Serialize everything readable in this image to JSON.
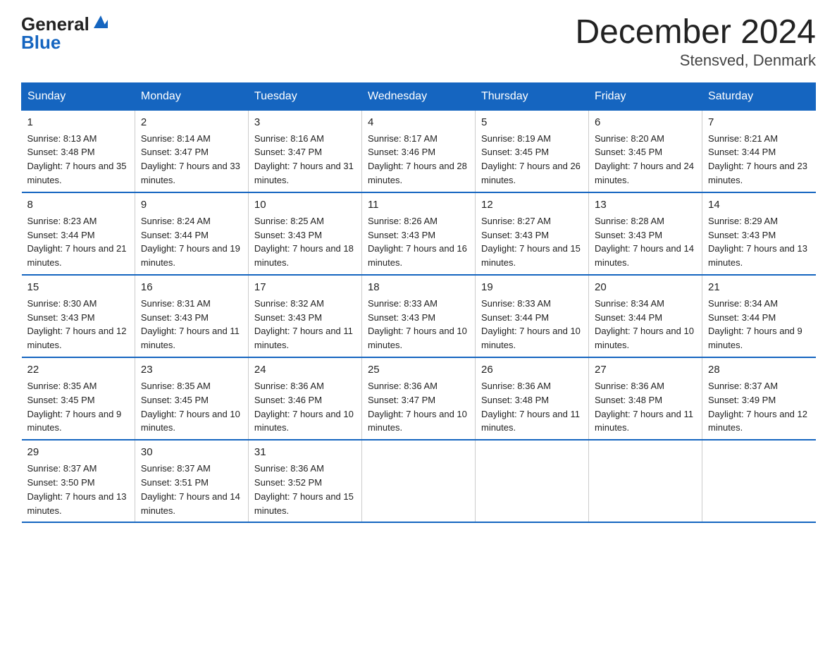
{
  "logo": {
    "general": "General",
    "blue": "Blue"
  },
  "title": "December 2024",
  "subtitle": "Stensved, Denmark",
  "days_of_week": [
    "Sunday",
    "Monday",
    "Tuesday",
    "Wednesday",
    "Thursday",
    "Friday",
    "Saturday"
  ],
  "weeks": [
    [
      {
        "day": "1",
        "sunrise": "8:13 AM",
        "sunset": "3:48 PM",
        "daylight": "7 hours and 35 minutes."
      },
      {
        "day": "2",
        "sunrise": "8:14 AM",
        "sunset": "3:47 PM",
        "daylight": "7 hours and 33 minutes."
      },
      {
        "day": "3",
        "sunrise": "8:16 AM",
        "sunset": "3:47 PM",
        "daylight": "7 hours and 31 minutes."
      },
      {
        "day": "4",
        "sunrise": "8:17 AM",
        "sunset": "3:46 PM",
        "daylight": "7 hours and 28 minutes."
      },
      {
        "day": "5",
        "sunrise": "8:19 AM",
        "sunset": "3:45 PM",
        "daylight": "7 hours and 26 minutes."
      },
      {
        "day": "6",
        "sunrise": "8:20 AM",
        "sunset": "3:45 PM",
        "daylight": "7 hours and 24 minutes."
      },
      {
        "day": "7",
        "sunrise": "8:21 AM",
        "sunset": "3:44 PM",
        "daylight": "7 hours and 23 minutes."
      }
    ],
    [
      {
        "day": "8",
        "sunrise": "8:23 AM",
        "sunset": "3:44 PM",
        "daylight": "7 hours and 21 minutes."
      },
      {
        "day": "9",
        "sunrise": "8:24 AM",
        "sunset": "3:44 PM",
        "daylight": "7 hours and 19 minutes."
      },
      {
        "day": "10",
        "sunrise": "8:25 AM",
        "sunset": "3:43 PM",
        "daylight": "7 hours and 18 minutes."
      },
      {
        "day": "11",
        "sunrise": "8:26 AM",
        "sunset": "3:43 PM",
        "daylight": "7 hours and 16 minutes."
      },
      {
        "day": "12",
        "sunrise": "8:27 AM",
        "sunset": "3:43 PM",
        "daylight": "7 hours and 15 minutes."
      },
      {
        "day": "13",
        "sunrise": "8:28 AM",
        "sunset": "3:43 PM",
        "daylight": "7 hours and 14 minutes."
      },
      {
        "day": "14",
        "sunrise": "8:29 AM",
        "sunset": "3:43 PM",
        "daylight": "7 hours and 13 minutes."
      }
    ],
    [
      {
        "day": "15",
        "sunrise": "8:30 AM",
        "sunset": "3:43 PM",
        "daylight": "7 hours and 12 minutes."
      },
      {
        "day": "16",
        "sunrise": "8:31 AM",
        "sunset": "3:43 PM",
        "daylight": "7 hours and 11 minutes."
      },
      {
        "day": "17",
        "sunrise": "8:32 AM",
        "sunset": "3:43 PM",
        "daylight": "7 hours and 11 minutes."
      },
      {
        "day": "18",
        "sunrise": "8:33 AM",
        "sunset": "3:43 PM",
        "daylight": "7 hours and 10 minutes."
      },
      {
        "day": "19",
        "sunrise": "8:33 AM",
        "sunset": "3:44 PM",
        "daylight": "7 hours and 10 minutes."
      },
      {
        "day": "20",
        "sunrise": "8:34 AM",
        "sunset": "3:44 PM",
        "daylight": "7 hours and 10 minutes."
      },
      {
        "day": "21",
        "sunrise": "8:34 AM",
        "sunset": "3:44 PM",
        "daylight": "7 hours and 9 minutes."
      }
    ],
    [
      {
        "day": "22",
        "sunrise": "8:35 AM",
        "sunset": "3:45 PM",
        "daylight": "7 hours and 9 minutes."
      },
      {
        "day": "23",
        "sunrise": "8:35 AM",
        "sunset": "3:45 PM",
        "daylight": "7 hours and 10 minutes."
      },
      {
        "day": "24",
        "sunrise": "8:36 AM",
        "sunset": "3:46 PM",
        "daylight": "7 hours and 10 minutes."
      },
      {
        "day": "25",
        "sunrise": "8:36 AM",
        "sunset": "3:47 PM",
        "daylight": "7 hours and 10 minutes."
      },
      {
        "day": "26",
        "sunrise": "8:36 AM",
        "sunset": "3:48 PM",
        "daylight": "7 hours and 11 minutes."
      },
      {
        "day": "27",
        "sunrise": "8:36 AM",
        "sunset": "3:48 PM",
        "daylight": "7 hours and 11 minutes."
      },
      {
        "day": "28",
        "sunrise": "8:37 AM",
        "sunset": "3:49 PM",
        "daylight": "7 hours and 12 minutes."
      }
    ],
    [
      {
        "day": "29",
        "sunrise": "8:37 AM",
        "sunset": "3:50 PM",
        "daylight": "7 hours and 13 minutes."
      },
      {
        "day": "30",
        "sunrise": "8:37 AM",
        "sunset": "3:51 PM",
        "daylight": "7 hours and 14 minutes."
      },
      {
        "day": "31",
        "sunrise": "8:36 AM",
        "sunset": "3:52 PM",
        "daylight": "7 hours and 15 minutes."
      },
      null,
      null,
      null,
      null
    ]
  ]
}
